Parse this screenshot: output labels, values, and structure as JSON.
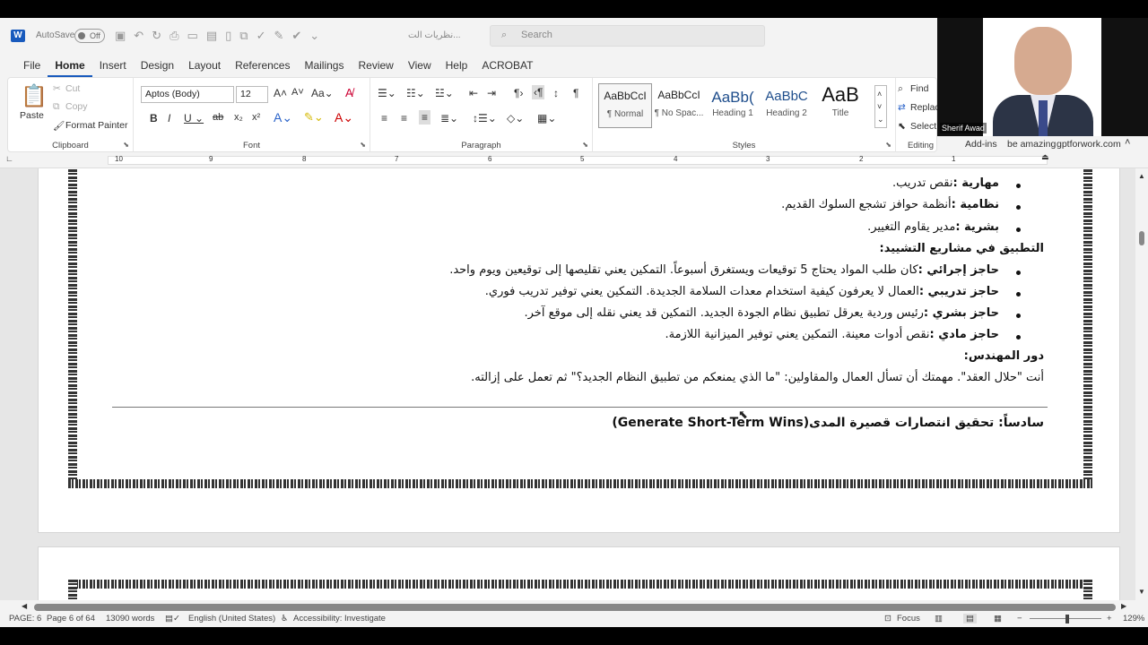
{
  "title_bar": {
    "autosave_label": "AutoSave",
    "autosave_state": "Off",
    "doc_title": "نظريات الت...",
    "search_placeholder": "Search"
  },
  "menu": {
    "tabs": [
      "File",
      "Home",
      "Insert",
      "Design",
      "Layout",
      "References",
      "Mailings",
      "Review",
      "View",
      "Help",
      "ACROBAT"
    ],
    "active": "Home"
  },
  "ribbon": {
    "clipboard": {
      "paste": "Paste",
      "cut": "Cut",
      "copy": "Copy",
      "format_painter": "Format Painter",
      "group": "Clipboard"
    },
    "font": {
      "family": "Aptos (Body)",
      "size": "12",
      "group": "Font"
    },
    "paragraph": {
      "group": "Paragraph"
    },
    "styles": {
      "items": [
        {
          "sample": "AaBbCcI",
          "name": "¶ Normal"
        },
        {
          "sample": "AaBbCcI",
          "name": "¶ No Spac..."
        },
        {
          "sample": "AaBb(",
          "name": "Heading 1"
        },
        {
          "sample": "AaBbC",
          "name": "Heading 2"
        },
        {
          "sample": "AaB",
          "name": "Title"
        }
      ],
      "group": "Styles"
    },
    "editing": {
      "find": "Find",
      "replace": "Replac",
      "select": "Select",
      "group": "Editing"
    },
    "addins": {
      "label": "Add-ins"
    },
    "extra": {
      "be_amazing": "be amazing",
      "site": "gptforwork.com"
    }
  },
  "webcam": {
    "name": "Sherif Awad"
  },
  "ruler": {
    "numbers": [
      "10",
      "9",
      "8",
      "7",
      "6",
      "5",
      "4",
      "3",
      "2",
      "1"
    ]
  },
  "document": {
    "lines": [
      {
        "bold": "مهارية :",
        "rest": "نقص تدريب.",
        "bullet": true
      },
      {
        "bold": "نظامية :",
        "rest": "أنظمة حوافز تشجع السلوك القديم.",
        "bullet": true
      },
      {
        "bold": "بشرية :",
        "rest": "مدير يقاوم التغيير.",
        "bullet": true
      },
      {
        "bold": "التطبيق في مشاريع التشييد:",
        "rest": "",
        "bullet": false
      },
      {
        "bold": "حاجز إجرائي :",
        "rest": "كان طلب المواد يحتاج 5 توقيعات ويستغرق أسبوعاً. التمكين يعني تقليصها إلى توقيعين ويوم واحد.",
        "bullet": true
      },
      {
        "bold": "حاجز تدريبي :",
        "rest": "العمال لا يعرفون كيفية استخدام معدات السلامة الجديدة. التمكين يعني توفير تدريب فوري.",
        "bullet": true
      },
      {
        "bold": "حاجز بشري :",
        "rest": "رئيس وردية يعرقل تطبيق نظام الجودة الجديد. التمكين قد يعني نقله إلى موقع آخر.",
        "bullet": true
      },
      {
        "bold": "حاجز مادي :",
        "rest": "نقص أدوات معينة. التمكين يعني توفير الميزانية اللازمة.",
        "bullet": true
      },
      {
        "bold": "دور المهندس:",
        "rest": "",
        "bullet": false
      },
      {
        "bold": "",
        "rest": "أنت \"حلال العقد\". مهمتك أن تسأل العمال والمقاولين: \"ما الذي يمنعكم من تطبيق النظام الجديد؟\" ثم تعمل على إزالته.",
        "bullet": false
      }
    ],
    "heading": "سادساً: تحقيق انتصارات قصيرة المدى(Generate Short-Term Wins)"
  },
  "status": {
    "page": "PAGE: 6",
    "page_of": "Page 6 of 64",
    "words": "13090 words",
    "language": "English (United States)",
    "accessibility": "Accessibility: Investigate",
    "focus": "Focus",
    "zoom": "129%"
  }
}
